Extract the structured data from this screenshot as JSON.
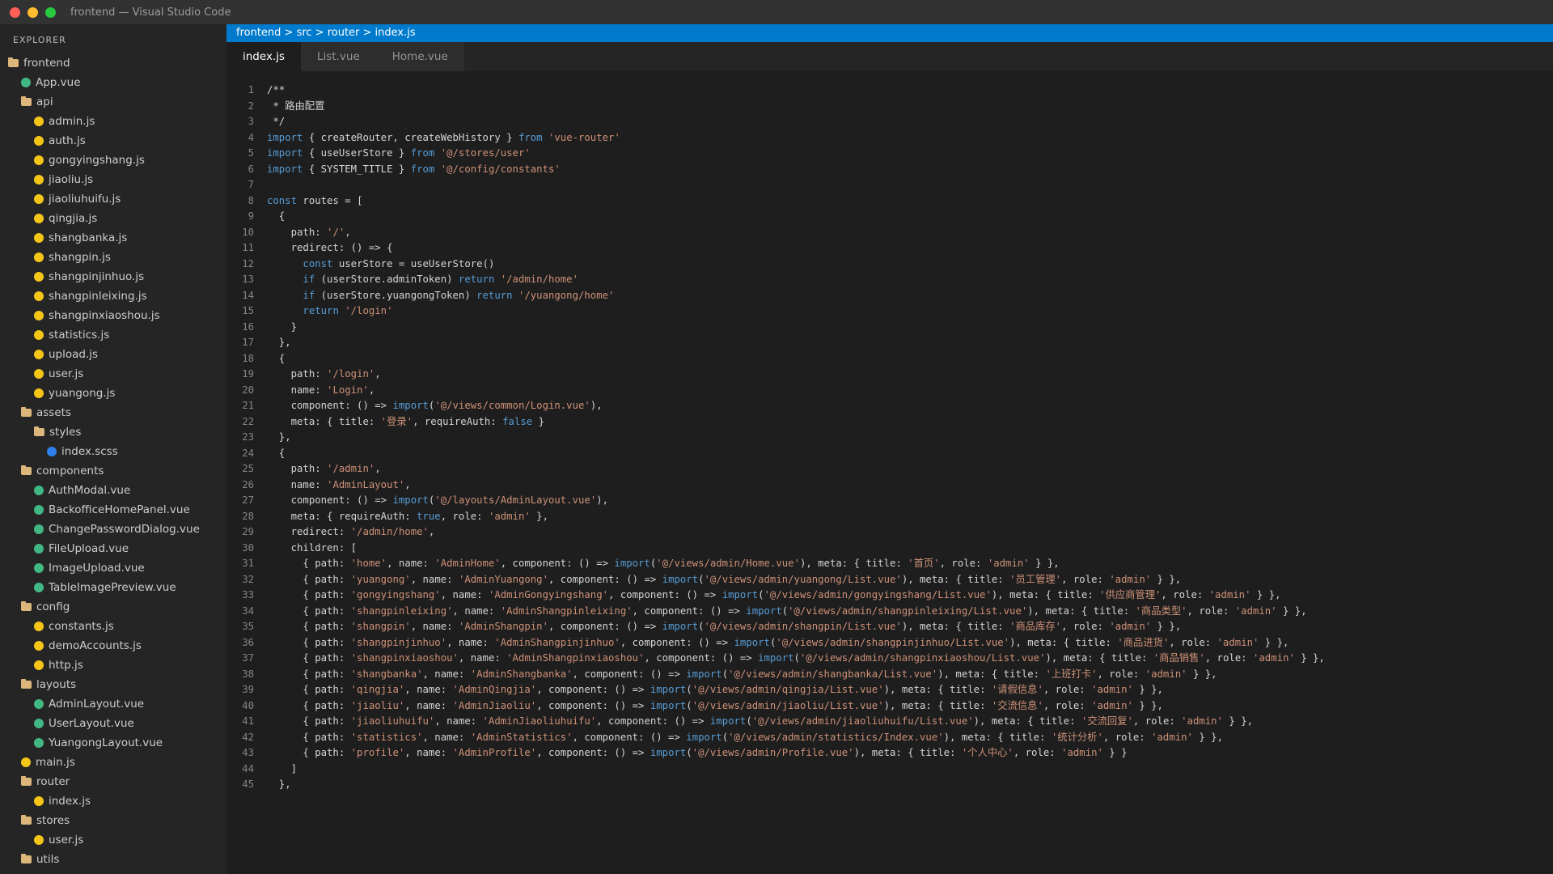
{
  "window": {
    "title": "frontend — Visual Studio Code"
  },
  "colors": {
    "accent": "#007acc",
    "editor_bg": "#1e1e1e",
    "sidebar_bg": "#252526",
    "keyword": "#569cd6",
    "string": "#ce9178"
  },
  "explorer": {
    "title": "EXPLORER",
    "items": [
      {
        "label": "frontend",
        "type": "folder",
        "depth": 0
      },
      {
        "label": "App.vue",
        "type": "vue",
        "depth": 1
      },
      {
        "label": "api",
        "type": "folder",
        "depth": 1
      },
      {
        "label": "admin.js",
        "type": "js",
        "depth": 2
      },
      {
        "label": "auth.js",
        "type": "js",
        "depth": 2
      },
      {
        "label": "gongyingshang.js",
        "type": "js",
        "depth": 2
      },
      {
        "label": "jiaoliu.js",
        "type": "js",
        "depth": 2
      },
      {
        "label": "jiaoliuhuifu.js",
        "type": "js",
        "depth": 2
      },
      {
        "label": "qingjia.js",
        "type": "js",
        "depth": 2
      },
      {
        "label": "shangbanka.js",
        "type": "js",
        "depth": 2
      },
      {
        "label": "shangpin.js",
        "type": "js",
        "depth": 2
      },
      {
        "label": "shangpinjinhuo.js",
        "type": "js",
        "depth": 2
      },
      {
        "label": "shangpinleixing.js",
        "type": "js",
        "depth": 2
      },
      {
        "label": "shangpinxiaoshou.js",
        "type": "js",
        "depth": 2
      },
      {
        "label": "statistics.js",
        "type": "js",
        "depth": 2
      },
      {
        "label": "upload.js",
        "type": "js",
        "depth": 2
      },
      {
        "label": "user.js",
        "type": "js",
        "depth": 2
      },
      {
        "label": "yuangong.js",
        "type": "js",
        "depth": 2
      },
      {
        "label": "assets",
        "type": "folder",
        "depth": 1
      },
      {
        "label": "styles",
        "type": "folder",
        "depth": 2
      },
      {
        "label": "index.scss",
        "type": "scss",
        "depth": 3
      },
      {
        "label": "components",
        "type": "folder",
        "depth": 1
      },
      {
        "label": "AuthModal.vue",
        "type": "vue",
        "depth": 2
      },
      {
        "label": "BackofficeHomePanel.vue",
        "type": "vue",
        "depth": 2
      },
      {
        "label": "ChangePasswordDialog.vue",
        "type": "vue",
        "depth": 2
      },
      {
        "label": "FileUpload.vue",
        "type": "vue",
        "depth": 2
      },
      {
        "label": "ImageUpload.vue",
        "type": "vue",
        "depth": 2
      },
      {
        "label": "TableImagePreview.vue",
        "type": "vue",
        "depth": 2
      },
      {
        "label": "config",
        "type": "folder",
        "depth": 1
      },
      {
        "label": "constants.js",
        "type": "js",
        "depth": 2
      },
      {
        "label": "demoAccounts.js",
        "type": "js",
        "depth": 2
      },
      {
        "label": "http.js",
        "type": "js",
        "depth": 2
      },
      {
        "label": "layouts",
        "type": "folder",
        "depth": 1
      },
      {
        "label": "AdminLayout.vue",
        "type": "vue",
        "depth": 2
      },
      {
        "label": "UserLayout.vue",
        "type": "vue",
        "depth": 2
      },
      {
        "label": "YuangongLayout.vue",
        "type": "vue",
        "depth": 2
      },
      {
        "label": "main.js",
        "type": "js",
        "depth": 1
      },
      {
        "label": "router",
        "type": "folder",
        "depth": 1
      },
      {
        "label": "index.js",
        "type": "js",
        "depth": 2
      },
      {
        "label": "stores",
        "type": "folder",
        "depth": 1
      },
      {
        "label": "user.js",
        "type": "js",
        "depth": 2
      },
      {
        "label": "utils",
        "type": "folder",
        "depth": 1
      }
    ]
  },
  "breadcrumb": "frontend > src > router > index.js",
  "tabs": [
    {
      "label": "index.js",
      "active": true
    },
    {
      "label": "List.vue",
      "active": false
    },
    {
      "label": "Home.vue",
      "active": false
    }
  ],
  "code_lines": [
    "/**",
    " * 路由配置",
    " */",
    "import { createRouter, createWebHistory } from 'vue-router'",
    "import { useUserStore } from '@/stores/user'",
    "import { SYSTEM_TITLE } from '@/config/constants'",
    "",
    "const routes = [",
    "  {",
    "    path: '/',",
    "    redirect: () => {",
    "      const userStore = useUserStore()",
    "      if (userStore.adminToken) return '/admin/home'",
    "      if (userStore.yuangongToken) return '/yuangong/home'",
    "      return '/login'",
    "    }",
    "  },",
    "  {",
    "    path: '/login',",
    "    name: 'Login',",
    "    component: () => import('@/views/common/Login.vue'),",
    "    meta: { title: '登录', requireAuth: false }",
    "  },",
    "  {",
    "    path: '/admin',",
    "    name: 'AdminLayout',",
    "    component: () => import('@/layouts/AdminLayout.vue'),",
    "    meta: { requireAuth: true, role: 'admin' },",
    "    redirect: '/admin/home',",
    "    children: [",
    "      { path: 'home', name: 'AdminHome', component: () => import('@/views/admin/Home.vue'), meta: { title: '首页', role: 'admin' } },",
    "      { path: 'yuangong', name: 'AdminYuangong', component: () => import('@/views/admin/yuangong/List.vue'), meta: { title: '员工管理', role: 'admin' } },",
    "      { path: 'gongyingshang', name: 'AdminGongyingshang', component: () => import('@/views/admin/gongyingshang/List.vue'), meta: { title: '供应商管理', role: 'admin' } },",
    "      { path: 'shangpinleixing', name: 'AdminShangpinleixing', component: () => import('@/views/admin/shangpinleixing/List.vue'), meta: { title: '商品类型', role: 'admin' } },",
    "      { path: 'shangpin', name: 'AdminShangpin', component: () => import('@/views/admin/shangpin/List.vue'), meta: { title: '商品库存', role: 'admin' } },",
    "      { path: 'shangpinjinhuo', name: 'AdminShangpinjinhuo', component: () => import('@/views/admin/shangpinjinhuo/List.vue'), meta: { title: '商品进货', role: 'admin' } },",
    "      { path: 'shangpinxiaoshou', name: 'AdminShangpinxiaoshou', component: () => import('@/views/admin/shangpinxiaoshou/List.vue'), meta: { title: '商品销售', role: 'admin' } },",
    "      { path: 'shangbanka', name: 'AdminShangbanka', component: () => import('@/views/admin/shangbanka/List.vue'), meta: { title: '上班打卡', role: 'admin' } },",
    "      { path: 'qingjia', name: 'AdminQingjia', component: () => import('@/views/admin/qingjia/List.vue'), meta: { title: '请假信息', role: 'admin' } },",
    "      { path: 'jiaoliu', name: 'AdminJiaoliu', component: () => import('@/views/admin/jiaoliu/List.vue'), meta: { title: '交流信息', role: 'admin' } },",
    "      { path: 'jiaoliuhuifu', name: 'AdminJiaoliuhuifu', component: () => import('@/views/admin/jiaoliuhuifu/List.vue'), meta: { title: '交流回复', role: 'admin' } },",
    "      { path: 'statistics', name: 'AdminStatistics', component: () => import('@/views/admin/statistics/Index.vue'), meta: { title: '统计分析', role: 'admin' } },",
    "      { path: 'profile', name: 'AdminProfile', component: () => import('@/views/admin/Profile.vue'), meta: { title: '个人中心', role: 'admin' } }",
    "    ]",
    "  },"
  ]
}
